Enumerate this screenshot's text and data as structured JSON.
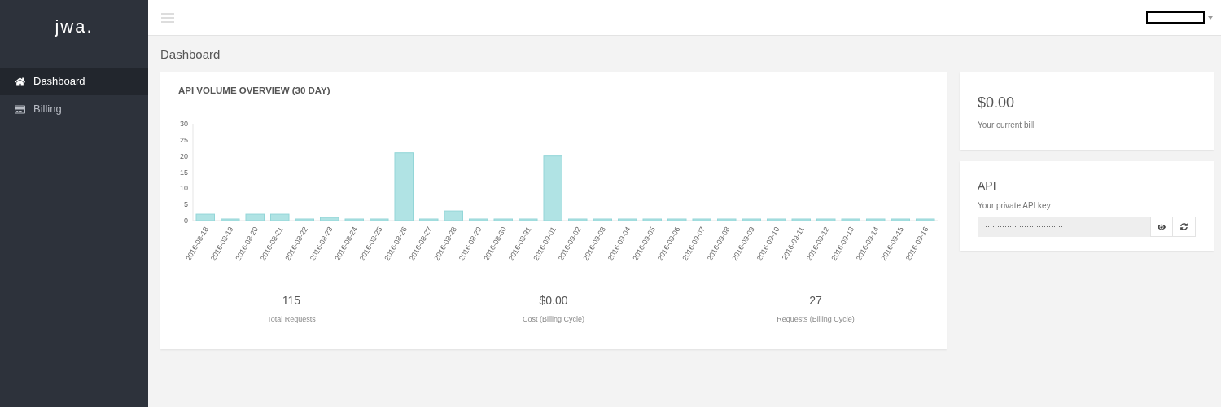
{
  "sidebar": {
    "logo": "jwa.",
    "items": [
      {
        "label": "Dashboard",
        "selected": true
      },
      {
        "label": "Billing",
        "selected": false
      }
    ]
  },
  "page_title": "Dashboard",
  "chart_card": {
    "title": "API VOLUME OVERVIEW (30 DAY)",
    "chart_data": {
      "type": "bar",
      "categories": [
        "2016-08-18",
        "2016-08-19",
        "2016-08-20",
        "2016-08-21",
        "2016-08-22",
        "2016-08-23",
        "2016-08-24",
        "2016-08-25",
        "2016-08-26",
        "2016-08-27",
        "2016-08-28",
        "2016-08-29",
        "2016-08-30",
        "2016-08-31",
        "2016-09-01",
        "2016-09-02",
        "2016-09-03",
        "2016-09-04",
        "2016-09-05",
        "2016-09-06",
        "2016-09-07",
        "2016-09-08",
        "2016-09-09",
        "2016-09-10",
        "2016-09-11",
        "2016-09-12",
        "2016-09-13",
        "2016-09-14",
        "2016-09-15",
        "2016-09-16"
      ],
      "series": [
        {
          "color": "#b0e3e4",
          "values": [
            2,
            0,
            2,
            2,
            0,
            1,
            0,
            0,
            21,
            0,
            3,
            0,
            0,
            0,
            20,
            0,
            0,
            0,
            0,
            0,
            0,
            0,
            0,
            0,
            0,
            0,
            0,
            0,
            0,
            0
          ]
        }
      ],
      "ylim": [
        0,
        30
      ],
      "yticks": [
        0,
        5,
        10,
        15,
        20,
        25,
        30
      ]
    },
    "stats": [
      {
        "value": "115",
        "label": "Total Requests"
      },
      {
        "value": "$0.00",
        "label": "Cost (Billing Cycle)"
      },
      {
        "value": "27",
        "label": "Requests (Billing Cycle)"
      }
    ]
  },
  "bill_card": {
    "amount": "$0.00",
    "label": "Your current bill"
  },
  "api_card": {
    "title": "API",
    "label": "Your private API key",
    "key": "································"
  }
}
